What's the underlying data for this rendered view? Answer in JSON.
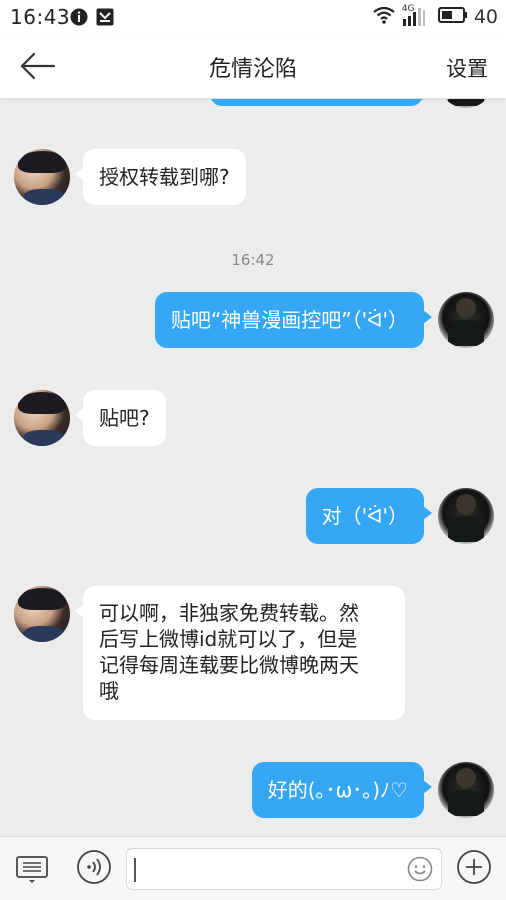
{
  "status_bar": {
    "time": "16:43",
    "battery": "40",
    "network": "4G",
    "icons": [
      "alert-circle-icon",
      "save-icon",
      "wifi-icon",
      "signal-icon",
      "battery-icon"
    ]
  },
  "header": {
    "back_icon": "arrow-left-icon",
    "title": "危情沦陷",
    "settings_label": "设置"
  },
  "messages": [
    {
      "side": "out",
      "text": "",
      "partial": true
    },
    {
      "side": "in",
      "text": "授权转载到哪?"
    },
    {
      "type": "timestamp",
      "text": "16:42"
    },
    {
      "side": "out",
      "text": "贴吧“神兽漫画控吧”（'ᐛ'）"
    },
    {
      "side": "in",
      "text": "贴吧?"
    },
    {
      "side": "out",
      "text": "对（'ᐛ'）"
    },
    {
      "side": "in",
      "lines": [
        "可以啊，非独家免费转载。然",
        "后写上微博id就可以了，但是",
        "记得每周连载要比微博晚两天",
        "哦"
      ]
    },
    {
      "side": "out",
      "text": "好的(｡･ω･｡)ﾉ♡"
    }
  ],
  "input_bar": {
    "keyboard_icon": "keyboard-icon",
    "voice_icon": "voice-icon",
    "emoji_icon": "emoji-icon",
    "plus_icon": "plus-icon",
    "value": "",
    "placeholder": ""
  },
  "colors": {
    "outgoing_bubble": "#36a7f5",
    "incoming_bubble": "#ffffff",
    "background": "#ececec"
  }
}
